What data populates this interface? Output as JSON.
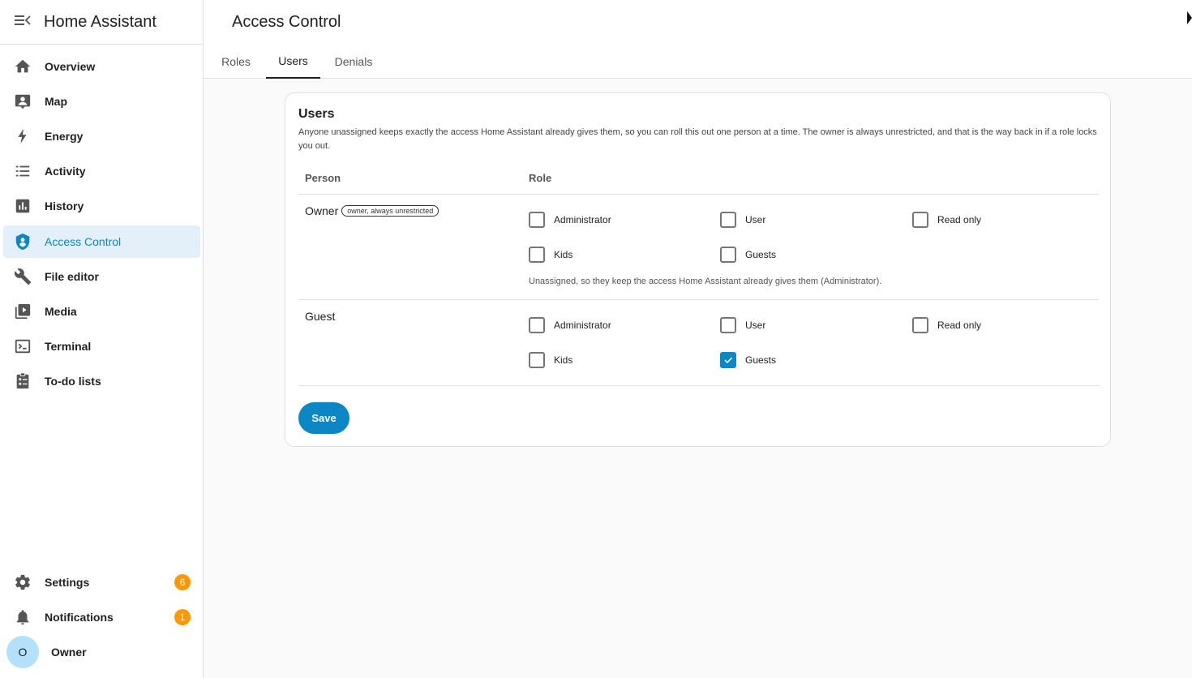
{
  "app": {
    "title": "Home Assistant"
  },
  "sidebar": {
    "items": [
      {
        "label": "Overview",
        "icon": "home-icon"
      },
      {
        "label": "Map",
        "icon": "map-icon"
      },
      {
        "label": "Energy",
        "icon": "lightning-icon"
      },
      {
        "label": "Activity",
        "icon": "list-icon"
      },
      {
        "label": "History",
        "icon": "chart-icon"
      },
      {
        "label": "Access Control",
        "icon": "shield-icon",
        "active": true
      },
      {
        "label": "File editor",
        "icon": "wrench-icon"
      },
      {
        "label": "Media",
        "icon": "media-icon"
      },
      {
        "label": "Terminal",
        "icon": "terminal-icon"
      },
      {
        "label": "To-do lists",
        "icon": "clipboard-list-icon"
      }
    ],
    "settings": {
      "label": "Settings",
      "badge": "6"
    },
    "notifications": {
      "label": "Notifications",
      "badge": "1"
    },
    "user": {
      "label": "Owner",
      "initial": "O"
    }
  },
  "page": {
    "title": "Access Control",
    "tabs": [
      "Roles",
      "Users",
      "Denials"
    ],
    "active_tab": "Users"
  },
  "users_card": {
    "title": "Users",
    "description": "Anyone unassigned keeps exactly the access Home Assistant already gives them, so you can roll this out one person at a time. The owner is always unrestricted, and that is the way back in if a role locks you out.",
    "columns": {
      "person": "Person",
      "role": "Role"
    },
    "rows": [
      {
        "person": "Owner",
        "chip": "owner, always unrestricted",
        "roles": [
          {
            "label": "Administrator",
            "checked": false
          },
          {
            "label": "User",
            "checked": false
          },
          {
            "label": "Read only",
            "checked": false
          },
          {
            "label": "Kids",
            "checked": false
          },
          {
            "label": "Guests",
            "checked": false
          }
        ],
        "note": "Unassigned, so they keep the access Home Assistant already gives them (Administrator)."
      },
      {
        "person": "Guest",
        "roles": [
          {
            "label": "Administrator",
            "checked": false
          },
          {
            "label": "User",
            "checked": false
          },
          {
            "label": "Read only",
            "checked": false
          },
          {
            "label": "Kids",
            "checked": false
          },
          {
            "label": "Guests",
            "checked": true
          }
        ]
      }
    ],
    "save_label": "Save"
  },
  "colors": {
    "accent": "#0a87c4",
    "badge": "#ff9800",
    "active_bg": "#e3f0fa"
  }
}
